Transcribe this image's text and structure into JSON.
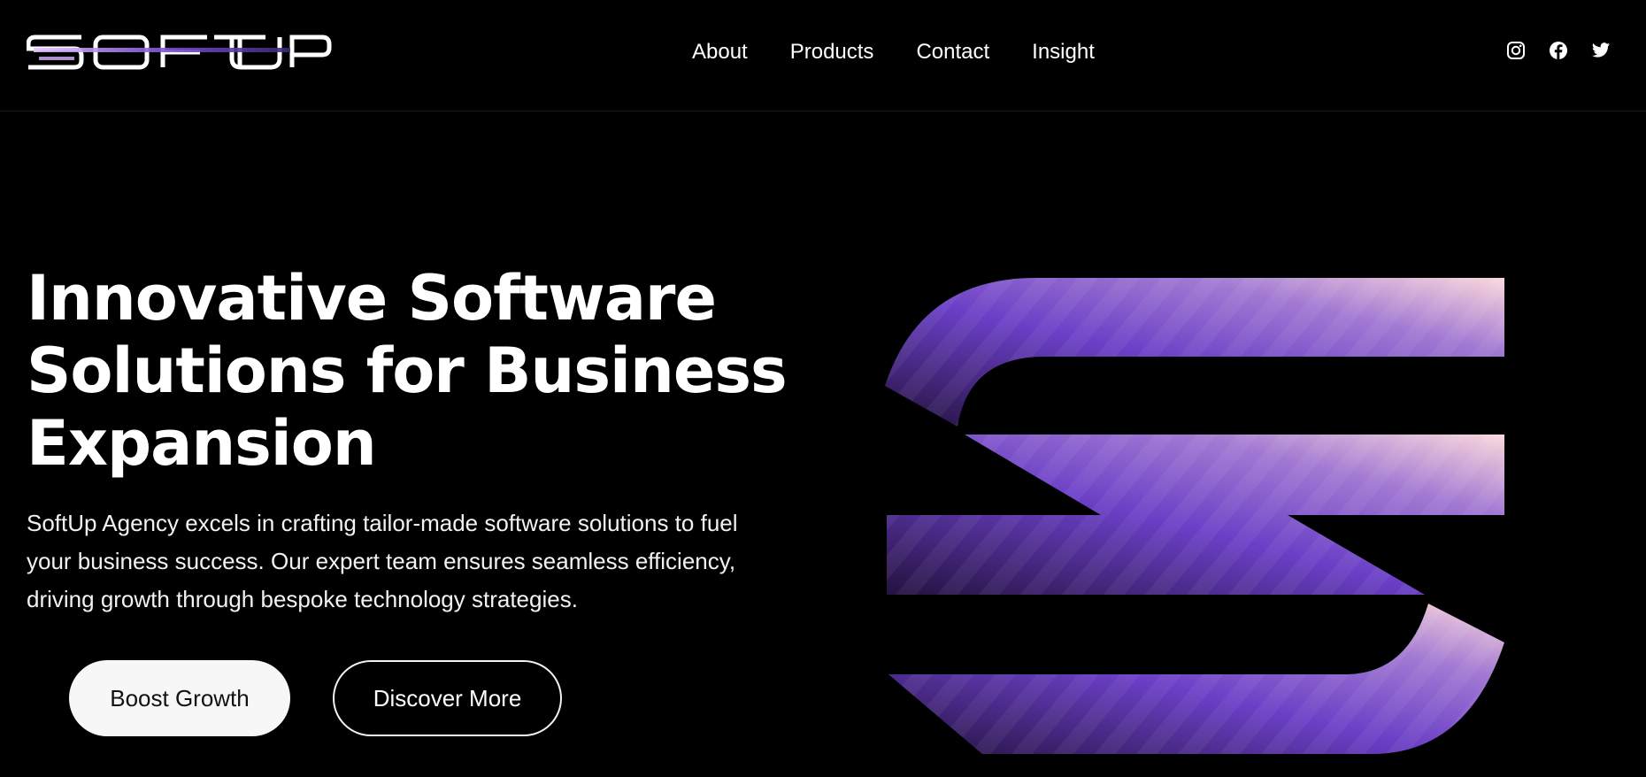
{
  "header": {
    "logo_text": "SOFT UP",
    "nav": [
      {
        "label": "About"
      },
      {
        "label": "Products"
      },
      {
        "label": "Contact"
      },
      {
        "label": "Insight"
      }
    ],
    "social_icons": [
      "instagram-icon",
      "facebook-icon",
      "twitter-icon"
    ]
  },
  "hero": {
    "title": "Innovative Software Solutions for Business Expansion",
    "description": "SoftUp Agency excels in crafting tailor-made software solutions to fuel your business success. Our expert team ensures seamless efficiency, driving growth through bespoke technology strategies.",
    "primary_button": "Boost Growth",
    "secondary_button": "Discover More",
    "art_icon": "s-logo-graphic"
  },
  "colors": {
    "background": "#000000",
    "text": "#ffffff",
    "accent_purple": "#6a3fc6",
    "accent_light": "#fad8dc"
  }
}
